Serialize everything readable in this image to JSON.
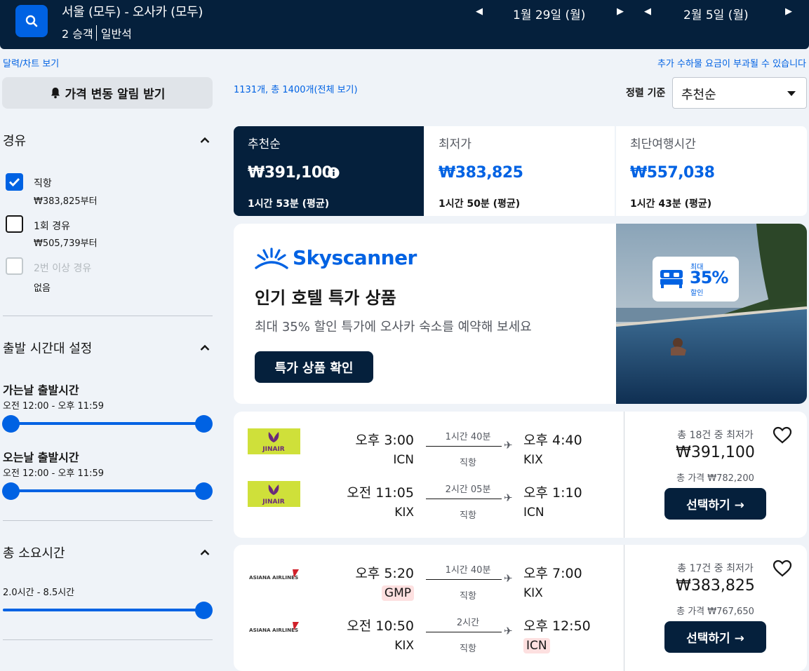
{
  "header": {
    "route": "서울 (모두) - 오사카 (모두)",
    "passengers": "2 승객",
    "cabin": "일반석",
    "depart_date": "1월 29일 (월)",
    "return_date": "2월 5일 (월)"
  },
  "links": {
    "calendar": "달력/차트 보기",
    "baggage_notice": "추가 수하물 요금이 부과될 수 있습니다"
  },
  "alert_button": "가격 변동 알림 받기",
  "filters": {
    "stops": {
      "title": "경유",
      "options": [
        {
          "label": "직항",
          "sub": "₩383,825부터",
          "state": "checked"
        },
        {
          "label": "1회 경유",
          "sub": "₩505,739부터",
          "state": "unchecked"
        },
        {
          "label": "2번 이상 경유",
          "sub": "없음",
          "state": "disabled"
        }
      ]
    },
    "departure_times": {
      "title": "출발 시간대 설정",
      "outbound": {
        "title": "가는날 출발시간",
        "range": "오전 12:00 - 오후 11:59"
      },
      "inbound": {
        "title": "오는날 출발시간",
        "range": "오전 12:00 - 오후 11:59"
      }
    },
    "duration": {
      "title": "총 소요시간",
      "range": "2.0시간 - 8.5시간"
    }
  },
  "results": {
    "count_text": "1131개, 총 1400개(전체 보기)",
    "sort_label": "정렬 기준",
    "sort_value": "추천순"
  },
  "tabs": [
    {
      "label": "추천순",
      "price": "₩391,100",
      "duration": "1시간 53분 (평균)"
    },
    {
      "label": "최저가",
      "price": "₩383,825",
      "duration": "1시간 50분 (평균)"
    },
    {
      "label": "최단여행시간",
      "price": "₩557,038",
      "duration": "1시간 43분 (평균)"
    }
  ],
  "ad": {
    "brand": "Skyscanner",
    "title": "인기 호텔 특가 상품",
    "subtitle": "최대 35% 할인 특가에 오사카 숙소를 예약해 보세요",
    "button": "특가 상품 확인",
    "badge_top": "최대",
    "badge_pct": "35%",
    "badge_bottom": "할인"
  },
  "flights": [
    {
      "airline_logo": "JINAIR",
      "deal_count": "총 18건 중 최저가",
      "price": "₩391,100",
      "total": "총 가격 ₩782,200",
      "button": "선택하기 →",
      "legs": [
        {
          "dep_time": "오후 3:00",
          "dep_code": "ICN",
          "duration": "1시간 40분",
          "stops": "직항",
          "arr_time": "오후 4:40",
          "arr_code": "KIX"
        },
        {
          "dep_time": "오전 11:05",
          "dep_code": "KIX",
          "duration": "2시간 05분",
          "stops": "직항",
          "arr_time": "오후 1:10",
          "arr_code": "ICN"
        }
      ]
    },
    {
      "airline_logo": "ASIANA AIRLINES",
      "deal_count": "총 17건 중 최저가",
      "price": "₩383,825",
      "total": "총 가격 ₩767,650",
      "button": "선택하기 →",
      "legs": [
        {
          "dep_time": "오후 5:20",
          "dep_code": "GMP",
          "duration": "1시간 40분",
          "stops": "직항",
          "arr_time": "오후 7:00",
          "arr_code": "KIX"
        },
        {
          "dep_time": "오전 10:50",
          "dep_code": "KIX",
          "duration": "2시간",
          "stops": "직항",
          "arr_time": "오후 12:50",
          "arr_code": "ICN"
        }
      ]
    }
  ]
}
